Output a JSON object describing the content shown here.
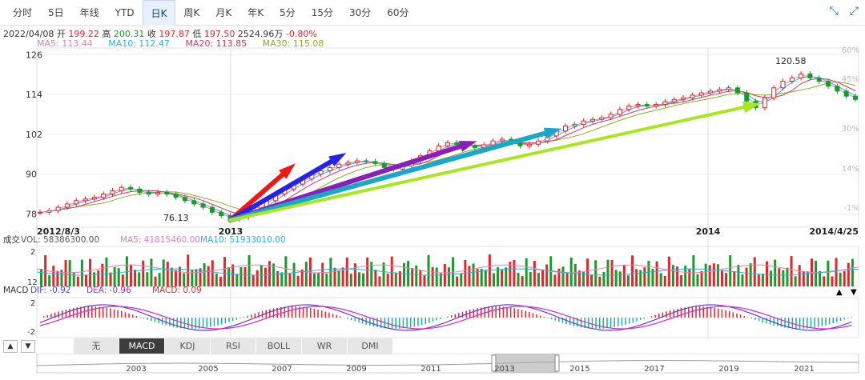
{
  "toolbar": {
    "tabs": [
      "分时",
      "5日",
      "年线",
      "YTD",
      "日K",
      "周K",
      "月K",
      "年K",
      "5分",
      "15分",
      "30分",
      "60分"
    ],
    "active": "日K"
  },
  "quote": {
    "date": "2022/04/08",
    "open_label": "开",
    "open": "199.22",
    "high_label": "高",
    "high": "200.31",
    "close_label": "收",
    "close": "197.87",
    "low_label": "低",
    "low": "197.50",
    "volume": "2524.96万",
    "change": "-0.80%"
  },
  "ma": {
    "ma5": "MA5: 113.44",
    "ma10": "MA10: 112.47",
    "ma20": "MA20: 113.85",
    "ma30": "MA30: 115.08",
    "colors": {
      "ma5": "#f07ab0",
      "ma10": "#1fb7e0",
      "ma20": "#e0306a",
      "ma30": "#8ab21b"
    }
  },
  "volume_info": {
    "label": "成交",
    "vol": "VOL: 58386300.00",
    "ma5": "MA5: 41815460.00",
    "ma10": "MA10: 51933010.00"
  },
  "macd_info": {
    "label": "MACD",
    "dif": "DIF: -0.92",
    "dea": "DEA: -0.96",
    "macd": "MACD: 0.09"
  },
  "indicator_tabs": [
    "无",
    "MACD",
    "KDJ",
    "RSI",
    "BOLL",
    "WR",
    "DMI"
  ],
  "indicator_active": "MACD",
  "navigator_years": [
    "2003",
    "2005",
    "2007",
    "2009",
    "2011",
    "2013",
    "2015",
    "2017",
    "2019",
    "2021"
  ],
  "chart_data": {
    "type": "line",
    "price_axis": {
      "ticks": [
        126,
        114,
        102,
        90,
        78
      ],
      "ylim": [
        74,
        128
      ]
    },
    "pct_axis": {
      "ticks": [
        "60%",
        "45%",
        "30%",
        "14%",
        "-1%"
      ]
    },
    "x_labels": [
      "2012/8/3",
      "2013",
      "2014",
      "2014/4/25"
    ],
    "annotations": {
      "low": "76.13",
      "high": "120.58"
    },
    "price_series": {
      "name": "close",
      "values": [
        78.5,
        79,
        80,
        81,
        82,
        82.5,
        83,
        84,
        85,
        86,
        85.5,
        84.5,
        84,
        84.5,
        84,
        83,
        82,
        81,
        80,
        78.5,
        77.5,
        76.5,
        77,
        78.5,
        80,
        82,
        84,
        85.5,
        87,
        88.5,
        90,
        91,
        92,
        93,
        93.5,
        94,
        93.8,
        93.2,
        92,
        91.5,
        92.5,
        94,
        95.5,
        97,
        98.5,
        99.5,
        99,
        98.5,
        98,
        98.8,
        100,
        100.5,
        99.5,
        98.5,
        99,
        100,
        101.5,
        103,
        104.5,
        105,
        106,
        106.5,
        107,
        108,
        109.5,
        110.5,
        111,
        110.5,
        111,
        111.8,
        112.5,
        113,
        113.8,
        114.5,
        115,
        115.5,
        116,
        114.5,
        112,
        110,
        113,
        116,
        118,
        119,
        120.2,
        119,
        118,
        116.5,
        115,
        113.5,
        112.5
      ]
    },
    "volume_axis": {
      "ticks": [
        "2",
        "12"
      ]
    },
    "macd_axis": {
      "ticks": [
        "2",
        "-2"
      ]
    },
    "arrows": [
      {
        "color": "#f01818"
      },
      {
        "color": "#2424e6"
      },
      {
        "color": "#8a1fb8"
      },
      {
        "color": "#19a8c8"
      },
      {
        "color": "#a8e61f"
      }
    ]
  }
}
